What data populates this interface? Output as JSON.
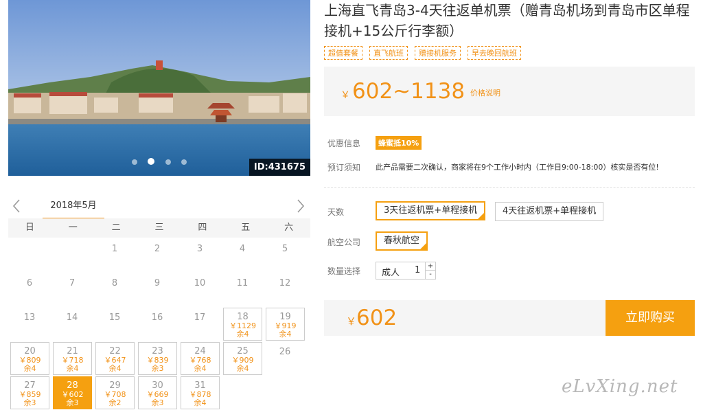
{
  "photo": {
    "id_label": "ID:431675",
    "slide_count": 4,
    "active_slide": 2
  },
  "calendar": {
    "month": "2018年5月",
    "weekdays": [
      "日",
      "一",
      "二",
      "三",
      "四",
      "五",
      "六"
    ],
    "weeks": [
      [
        null,
        null,
        {
          "day": "1"
        },
        {
          "day": "2"
        },
        {
          "day": "3"
        },
        {
          "day": "4"
        },
        {
          "day": "5"
        }
      ],
      [
        {
          "day": "6"
        },
        {
          "day": "7"
        },
        {
          "day": "8"
        },
        {
          "day": "9"
        },
        {
          "day": "10"
        },
        {
          "day": "11"
        },
        {
          "day": "12"
        }
      ],
      [
        {
          "day": "13"
        },
        {
          "day": "14"
        },
        {
          "day": "15"
        },
        {
          "day": "16"
        },
        {
          "day": "17"
        },
        {
          "day": "18",
          "price": "￥1129",
          "left": "余4"
        },
        {
          "day": "19",
          "price": "￥919",
          "left": "余4"
        }
      ],
      [
        {
          "day": "20",
          "price": "￥809",
          "left": "余4"
        },
        {
          "day": "21",
          "price": "￥718",
          "left": "余4"
        },
        {
          "day": "22",
          "price": "￥647",
          "left": "余4"
        },
        {
          "day": "23",
          "price": "￥839",
          "left": "余3"
        },
        {
          "day": "24",
          "price": "￥768",
          "left": "余4"
        },
        {
          "day": "25",
          "price": "￥909",
          "left": "余4"
        },
        {
          "day": "26"
        }
      ],
      [
        {
          "day": "27",
          "price": "￥859",
          "left": "余3"
        },
        {
          "day": "28",
          "price": "￥602",
          "left": "余3",
          "selected": true
        },
        {
          "day": "29",
          "price": "￥708",
          "left": "余2"
        },
        {
          "day": "30",
          "price": "￥669",
          "left": "余3"
        },
        {
          "day": "31",
          "price": "￥878",
          "left": "余4"
        },
        null,
        null
      ]
    ]
  },
  "product": {
    "title": "上海直飞青岛3-4天往返单机票（赠青岛机场到青岛市区单程接机+15公斤行李额）",
    "tags": [
      "超值套餐",
      "直飞航班",
      "赠接机服务",
      "早去晚回航班"
    ],
    "price_yen": "￥",
    "price_range": "602~1138",
    "price_note": "价格说明",
    "promo_label": "优惠信息",
    "promo_badge": "蜂蜜抵10%",
    "notice_label": "预订须知",
    "notice_text": "此产品需要二次确认，商家将在9个工作小时内（工作日9:00-18:00）核实是否有位!",
    "days_label": "天数",
    "days_options": [
      "3天往返机票+单程接机",
      "4天往返机票+单程接机"
    ],
    "airline_label": "航空公司",
    "airline_option": "春秋航空",
    "qty_label": "数量选择",
    "qty_type": "成人",
    "qty_value": "1",
    "qty_plus": "+",
    "qty_minus": "-",
    "total_yen": "￥",
    "total_price": "602",
    "buy_label": "立即购买"
  },
  "watermark": "eLvXing.net",
  "colors": {
    "accent": "#f5a010",
    "price": "#f19218",
    "panel": "#f5f5f5"
  }
}
